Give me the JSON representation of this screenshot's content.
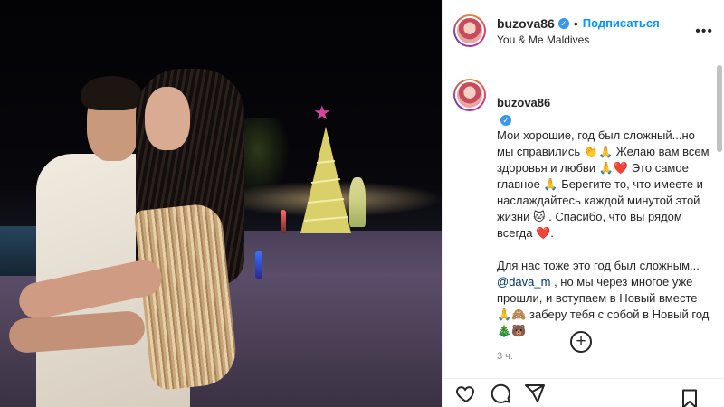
{
  "post": {
    "username": "buzova86",
    "separator": "•",
    "follow_label": "Подписаться",
    "location": "You & Me Maldives",
    "more_label": "•••"
  },
  "caption": {
    "username": "buzova86",
    "paragraph1": "Мои хорошие, год был сложный...но мы справились 👏🙏 Желаю вам всем здоровья и любви 🙏❤️ Это самое главное 🙏 Берегите то, что имеете и наслаждайтесь каждой минутой этой жизни 🐱 . Спасибо, что вы рядом всегда ❤️.",
    "paragraph2_before": "Для нас тоже это год был сложным... ",
    "mention": "@dava_m",
    "paragraph2_after": " , но мы через многое уже прошли, и вступаем в Новый вместе 🙏🙈 заберу тебя с собой в Новый год 🎄🐻",
    "time": "3 ч."
  },
  "add_comment": "+",
  "icons": {
    "like": "heart-icon",
    "comment": "comment-icon",
    "share": "share-icon",
    "save": "bookmark-icon",
    "verified": "verified-badge-icon",
    "add": "add-circle-icon"
  },
  "colors": {
    "accent": "#0095f6",
    "verified": "#3897f0",
    "text": "#262626",
    "muted": "#8e8e8e",
    "border": "#efefef"
  }
}
